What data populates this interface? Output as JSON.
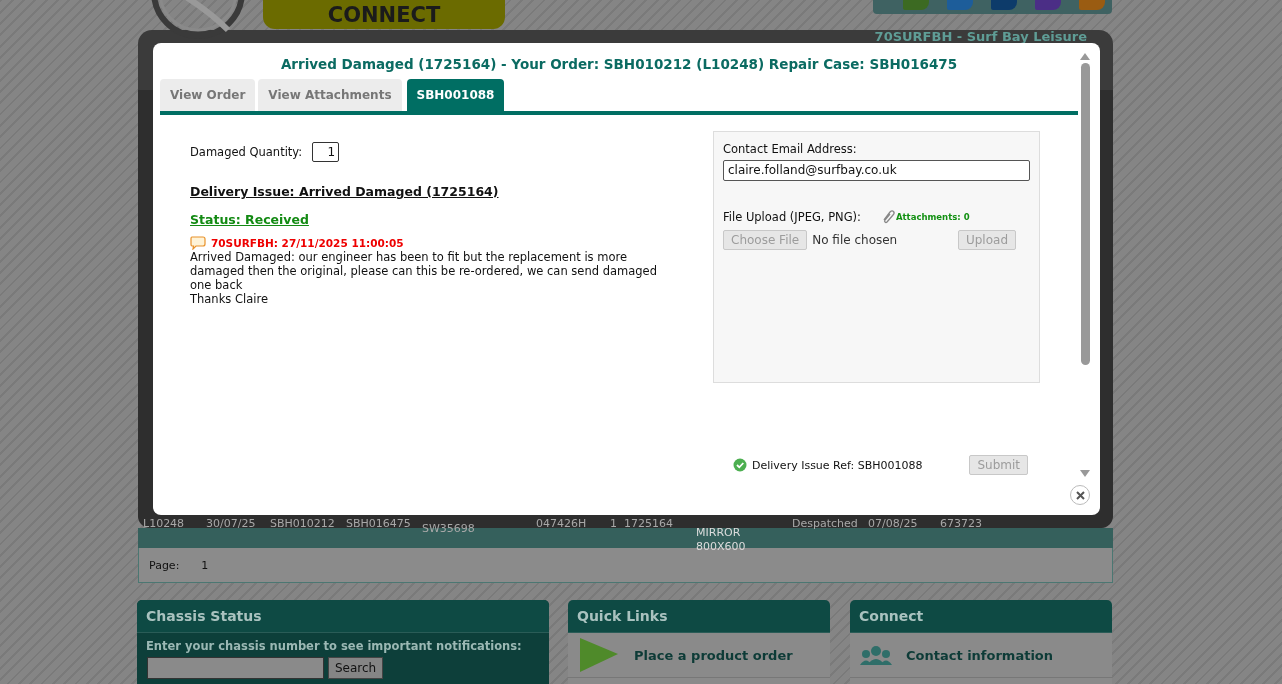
{
  "header": {
    "banner": "CONNECT",
    "account": "70SURFBH - Surf Bay Leisure"
  },
  "orders_table": {
    "rows": [
      {
        "cells": [
          "L10248",
          "30/07/25",
          "SBH010212",
          "SBH016475",
          "SW35698",
          "047426H",
          "1",
          "1725164",
          "MIRROR 800X600",
          "Despatched",
          "07/08/25",
          "673723"
        ]
      }
    ]
  },
  "pager": {
    "label": "Page:",
    "page": "1"
  },
  "panels": [
    {
      "kind": "chassis",
      "title": "Chassis Status",
      "prompt": "Enter your chassis number to see important notifications:",
      "button": "Search"
    },
    {
      "kind": "quick_links",
      "title": "Quick Links",
      "items": [
        "Place a product order"
      ]
    },
    {
      "kind": "connect",
      "title": "Connect",
      "items": [
        "Contact information"
      ]
    }
  ],
  "modal": {
    "title": "Arrived Damaged (1725164) - Your Order: SBH010212 (L10248) Repair Case: SBH016475",
    "tabs": [
      {
        "label": "View Order",
        "selected": false
      },
      {
        "label": "View Attachments",
        "selected": false
      },
      {
        "label": "SBH001088",
        "selected": true
      }
    ],
    "damaged_quantity": {
      "label": "Damaged Quantity:",
      "value": "1"
    },
    "issue_heading": "Delivery Issue: Arrived Damaged (1725164)",
    "status": "Status: Received",
    "comments": [
      {
        "author_time": "70SURFBH: 27/11/2025 11:00:05",
        "lines": [
          "Arrived Damaged: our engineer has been to fit but the replacement is more damaged then the original, please can this be re-ordered, we can send damaged one back",
          "Thanks Claire"
        ]
      }
    ],
    "email": {
      "label": "Contact Email Address:",
      "value": "claire.folland@surfbay.co.uk"
    },
    "upload": {
      "label": "File Upload (JPEG, PNG):",
      "attachments": "Attachments: 0",
      "choose_button": "Choose File",
      "file_status": "No file chosen",
      "upload_button": "Upload",
      "disabled": true
    },
    "reference": "Delivery Issue Ref: SBH001088",
    "submit": {
      "label": "Submit",
      "disabled": true
    }
  }
}
